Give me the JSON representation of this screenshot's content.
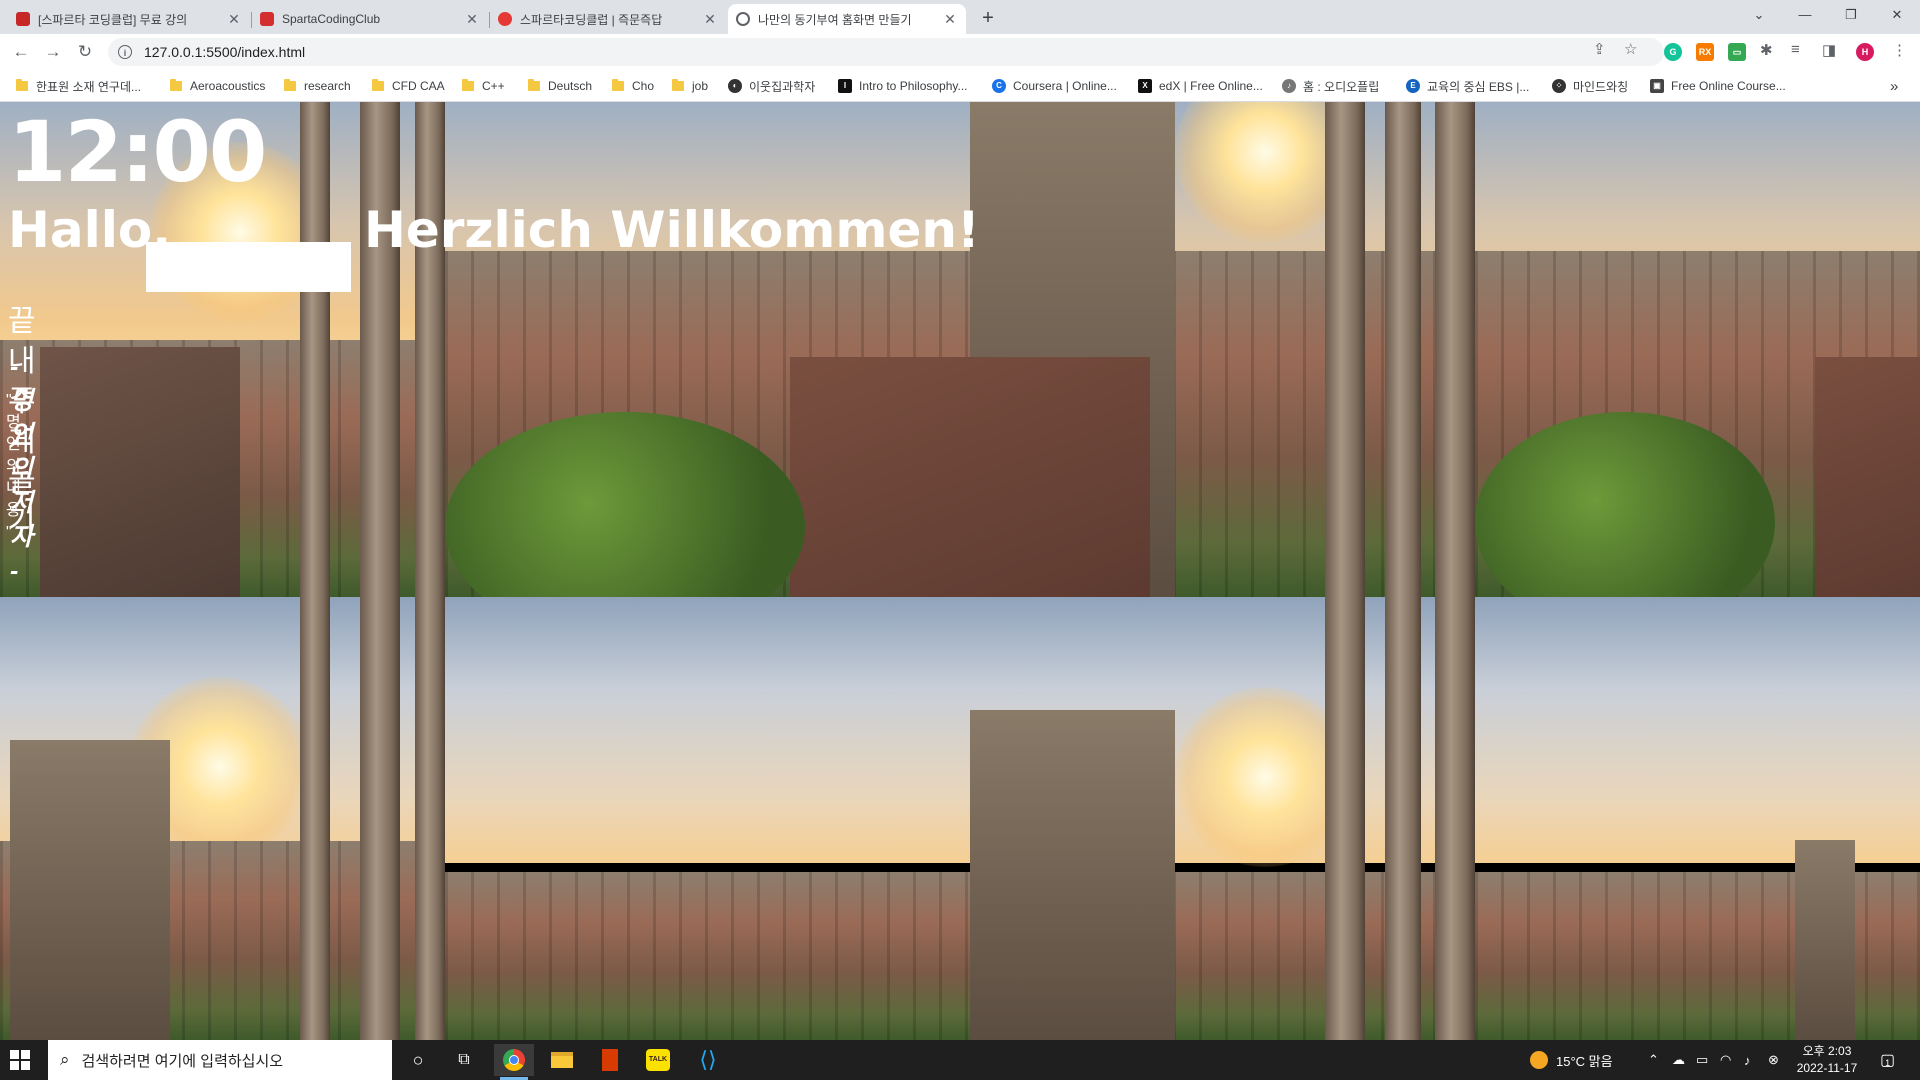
{
  "browser": {
    "tabs": [
      {
        "title": "[스파르타 코딩클럽] 무료 강의",
        "favicon_color": "#c62828"
      },
      {
        "title": "SpartaCodingClub",
        "favicon_color": "#d32f2f"
      },
      {
        "title": "스파르타코딩클럽 | 즉문즉답",
        "favicon_color": "#e53935"
      },
      {
        "title": "나만의 동기부여 홈화면 만들기",
        "favicon_color": "#5f6368"
      }
    ],
    "new_tab_label": "+",
    "window_controls": {
      "chevron": "⌄",
      "minimize": "—",
      "restore": "❐",
      "close": "✕"
    },
    "url": "127.0.0.1:5500/index.html",
    "avatar_letter": "H",
    "bookmarks": [
      {
        "label": "한표원 소재 연구데...",
        "kind": "folder"
      },
      {
        "label": "Aeroacoustics",
        "kind": "folder"
      },
      {
        "label": "research",
        "kind": "folder"
      },
      {
        "label": "CFD CAA",
        "kind": "folder"
      },
      {
        "label": "C++",
        "kind": "folder"
      },
      {
        "label": "Deutsch",
        "kind": "folder"
      },
      {
        "label": "Cho",
        "kind": "folder"
      },
      {
        "label": "job",
        "kind": "folder"
      },
      {
        "label": "이웃집과학자",
        "kind": "site",
        "icon": "◐",
        "color": "#333333"
      },
      {
        "label": "Intro to Philosophy...",
        "kind": "site",
        "icon": "I",
        "color": "#111111"
      },
      {
        "label": "Coursera | Online...",
        "kind": "site",
        "icon": "C",
        "color": "#1a73e8"
      },
      {
        "label": "edX | Free Online...",
        "kind": "site",
        "icon": "X",
        "color": "#111111"
      },
      {
        "label": "홈 : 오디오플립",
        "kind": "site",
        "icon": "♪",
        "color": "#777777"
      },
      {
        "label": "교육의 중심 EBS |...",
        "kind": "site",
        "icon": "E",
        "color": "#1565c0"
      },
      {
        "label": "마인드와칭",
        "kind": "site",
        "icon": "⁘",
        "color": "#333333"
      },
      {
        "label": "Free Online Course...",
        "kind": "site",
        "icon": "▣",
        "color": "#444444"
      }
    ],
    "more_bookmarks": "»"
  },
  "page": {
    "clock": "12:00",
    "greeting_prefix": "Hallo,",
    "greeting_suffix": "Herzlich Willkommen!",
    "todo": "끝내주게 놀기",
    "quote_author": "- 명언의 저자 -",
    "quote_text": "\" 명언의 내용 \""
  },
  "taskbar": {
    "search_placeholder": "검색하려면 여기에 입력하십시오",
    "weather": "15°C  맑음",
    "time": "오후 2:03",
    "date": "2022-11-17",
    "notification_count": "1"
  }
}
